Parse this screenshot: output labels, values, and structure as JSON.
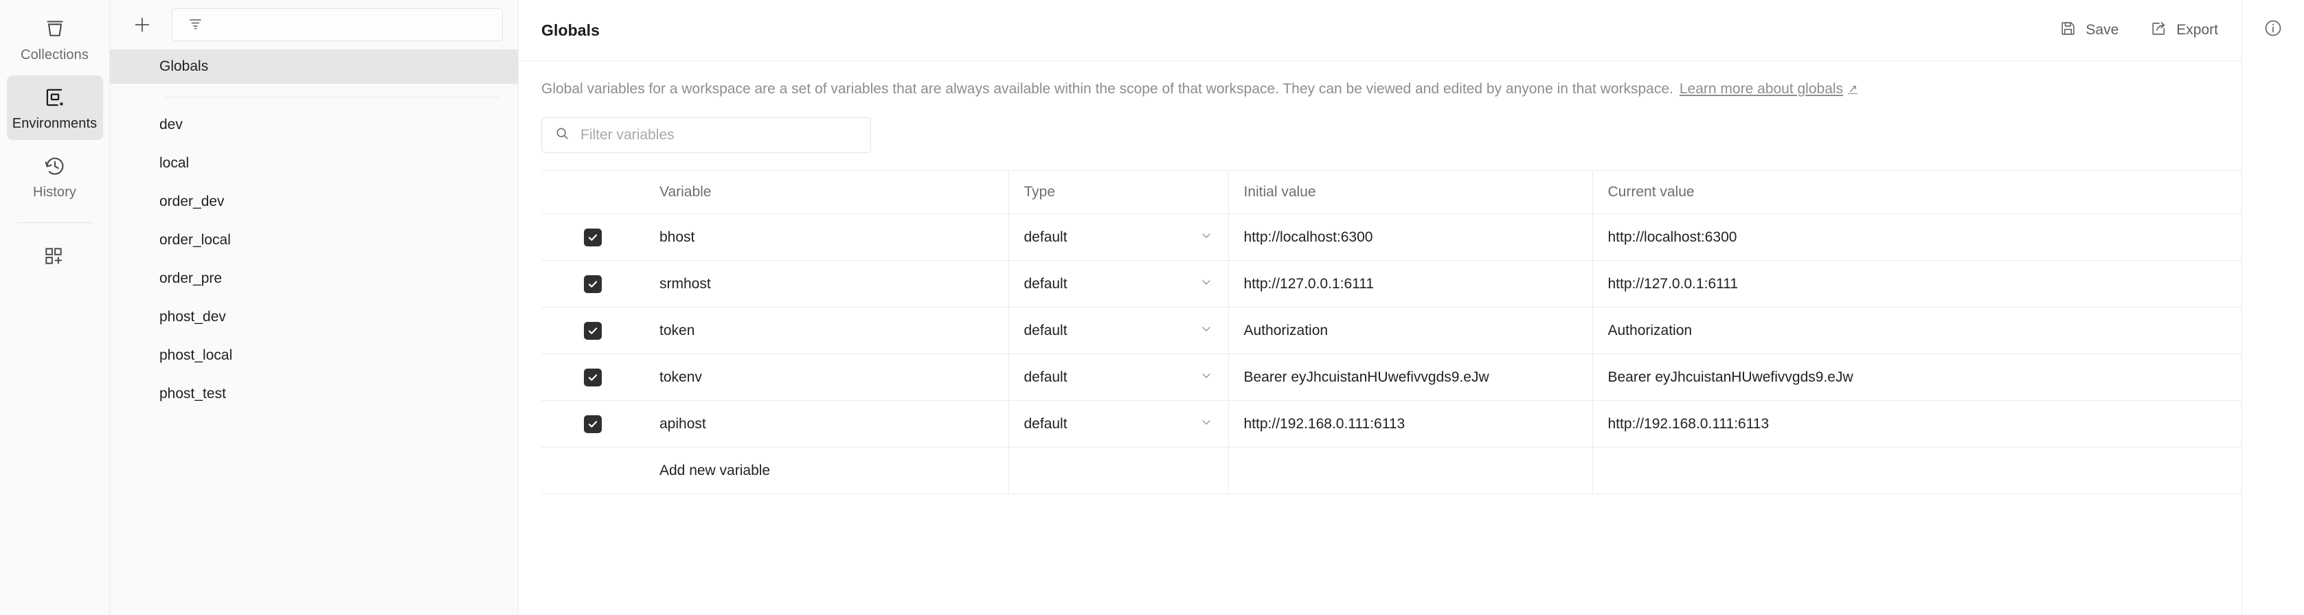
{
  "rail": {
    "items": [
      {
        "label": "Collections",
        "icon": "collections-icon",
        "active": false
      },
      {
        "label": "Environments",
        "icon": "environments-icon",
        "active": true
      },
      {
        "label": "History",
        "icon": "history-icon",
        "active": false
      }
    ],
    "new_icon_label": "new-grid-icon"
  },
  "sidebar": {
    "create_button_label": "+",
    "filter_icon_label": "filter-icon",
    "globals_label": "Globals",
    "environments": [
      {
        "label": "dev"
      },
      {
        "label": "local"
      },
      {
        "label": "order_dev"
      },
      {
        "label": "order_local"
      },
      {
        "label": "order_pre"
      },
      {
        "label": "phost_dev"
      },
      {
        "label": "phost_local"
      },
      {
        "label": "phost_test"
      }
    ]
  },
  "header": {
    "title": "Globals",
    "save_label": "Save",
    "export_label": "Export",
    "info_icon_label": "info-icon"
  },
  "description": {
    "text": "Global variables for a workspace are a set of variables that are always available within the scope of that workspace. They can be viewed and edited by anyone in that workspace.",
    "link_text": "Learn more about globals",
    "link_arrow": "↗"
  },
  "search": {
    "placeholder": "Filter variables",
    "value": "",
    "icon": "search-icon"
  },
  "table": {
    "columns": [
      "Variable",
      "Type",
      "Initial value",
      "Current value"
    ],
    "menu_label": "•••",
    "rows": [
      {
        "enabled": true,
        "variable": "bhost",
        "type": "default",
        "initial_value": "http://localhost:6300",
        "current_value": "http://localhost:6300"
      },
      {
        "enabled": true,
        "variable": "srmhost",
        "type": "default",
        "initial_value": "http://127.0.0.1:6111",
        "current_value": "http://127.0.0.1:6111"
      },
      {
        "enabled": true,
        "variable": "token",
        "type": "default",
        "initial_value": "Authorization",
        "current_value": "Authorization"
      },
      {
        "enabled": true,
        "variable": "tokenv",
        "type": "default",
        "initial_value": "Bearer eyJhcuistanHUwefivvgds9.eJw",
        "current_value": "Bearer eyJhcuistanHUwefivvgds9.eJw"
      },
      {
        "enabled": true,
        "variable": "apihost",
        "type": "default",
        "initial_value": "http://192.168.0.111:6113",
        "current_value": "http://192.168.0.111:6113"
      }
    ],
    "new_row_placeholder": "Add new variable"
  },
  "colors": {
    "page_bg": "#ffffff",
    "panel_bg": "#fafafa",
    "border": "#ededed",
    "text": "#212121",
    "muted_text": "#8d8d8d",
    "active_bg": "#e6e6e6",
    "checkbox": "#2f2f2f"
  }
}
